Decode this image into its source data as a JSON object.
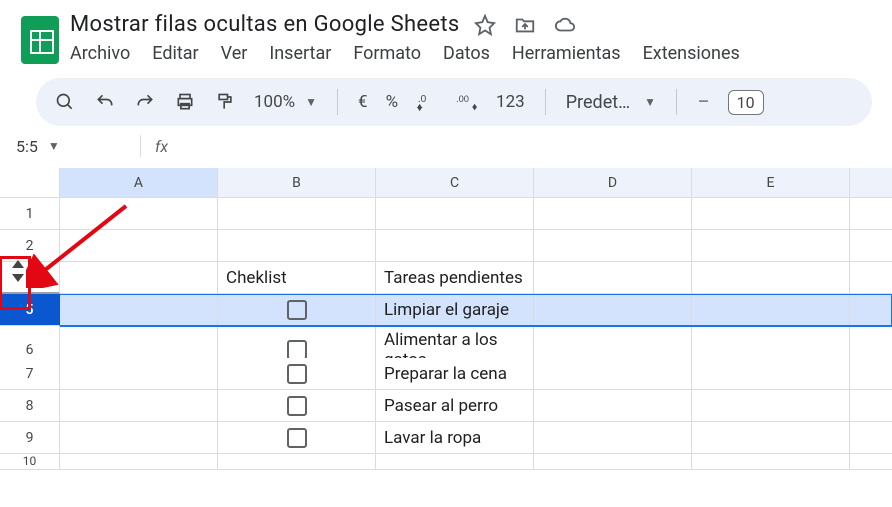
{
  "header": {
    "doc_title": "Mostrar filas ocultas en Google Sheets"
  },
  "menubar": {
    "items": [
      "Archivo",
      "Editar",
      "Ver",
      "Insertar",
      "Formato",
      "Datos",
      "Herramientas",
      "Extensiones"
    ]
  },
  "toolbar": {
    "zoom": "100%",
    "currency": "€",
    "percent": "%",
    "dec_dec": ".0",
    "dec_inc": ".00",
    "number_fmt": "123",
    "font_name": "Predet…",
    "font_size": "10"
  },
  "namebox": {
    "value": "5:5"
  },
  "fx": {
    "value": ""
  },
  "columns": [
    "A",
    "B",
    "C",
    "D",
    "E"
  ],
  "rows": [
    {
      "num": "1",
      "cells": [
        "",
        "",
        "",
        "",
        ""
      ],
      "selected": false
    },
    {
      "num": "2",
      "cells": [
        "",
        "",
        "",
        "",
        ""
      ],
      "selected": false
    },
    {
      "num": "5",
      "cells": [
        "",
        "☐",
        "Limpiar el garaje",
        "",
        ""
      ],
      "selected": true
    },
    {
      "num": "6",
      "cells": [
        "",
        "☐",
        "Alimentar a los gatos",
        "",
        ""
      ],
      "selected": false
    },
    {
      "num": "7",
      "cells": [
        "",
        "☐",
        "Preparar la cena",
        "",
        ""
      ],
      "selected": false
    },
    {
      "num": "8",
      "cells": [
        "",
        "☐",
        "Pasear al perro",
        "",
        ""
      ],
      "selected": false
    },
    {
      "num": "9",
      "cells": [
        "",
        "☐",
        "Lavar la ropa",
        "",
        ""
      ],
      "selected": false
    },
    {
      "num": "10",
      "cells": [
        "",
        "",
        "",
        "",
        ""
      ],
      "selected": false
    }
  ],
  "header_content_row": {
    "b": "Cheklist",
    "c": "Tareas pendientes"
  },
  "hidden_rows_between": {
    "after_row": "2",
    "before_row": "5"
  }
}
